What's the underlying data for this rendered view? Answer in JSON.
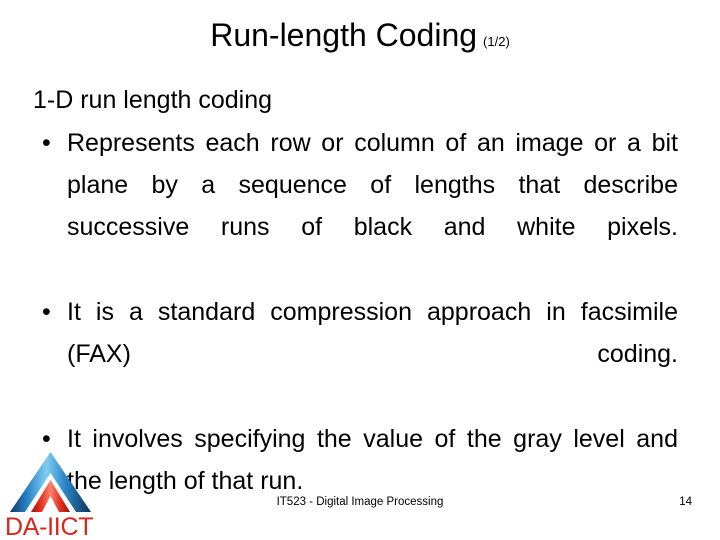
{
  "slide": {
    "title_main": "Run-length Coding",
    "title_part": "(1/2)",
    "lead_line": "1-D run length coding",
    "bullet_mark": "•",
    "bullets": [
      "Represents each row or column of an image or a bit plane by a sequence of lengths that describe successive runs of black and white pixels.",
      "It is a standard compression approach in facsimile (FAX) coding.",
      "It involves specifying the value of the gray level and the length of that run."
    ]
  },
  "footer": {
    "course": "IT523 - Digital Image Processing",
    "page_number": "14"
  },
  "logo": {
    "text": "DA-IICT",
    "blue": "#1d6fb5",
    "blue_light": "#66b8e8",
    "blue_dark": "#0b3c6b",
    "red": "#e02718",
    "red_dark": "#a8150c",
    "red_light": "#f4705f"
  },
  "colors": {
    "background": "#ffffff",
    "text": "#000000"
  }
}
